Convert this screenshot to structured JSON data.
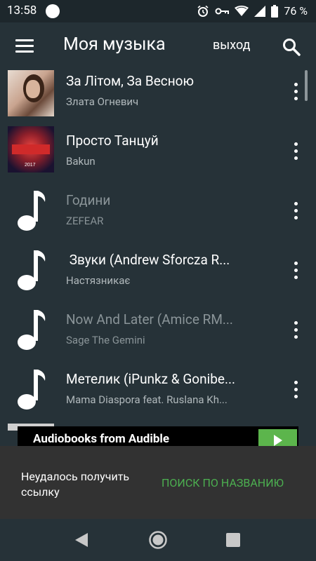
{
  "status_bar": {
    "time": "13:58",
    "battery": "76 %",
    "icons": [
      "alarm-icon",
      "vpn-key-icon",
      "wifi-icon",
      "signal-icon",
      "battery-icon"
    ]
  },
  "app_bar": {
    "title": "Моя музыка",
    "exit_label": "выход"
  },
  "tracks": [
    {
      "title": "За Літом, За Весною",
      "artist": "Злата Огневич",
      "has_cover": true,
      "dimmed": false
    },
    {
      "title": "Просто Танцуй",
      "artist": "Bakun",
      "has_cover": true,
      "dimmed": false
    },
    {
      "title": "Години",
      "artist": "ZEFEAR",
      "has_cover": false,
      "dimmed": true
    },
    {
      "title": " Звуки (Andrew Sforcza R...",
      "artist": "Настязникає",
      "has_cover": false,
      "dimmed": false
    },
    {
      "title": "Now And Later (Amice RM...",
      "artist": "Sage The Gemini",
      "has_cover": false,
      "dimmed": true
    },
    {
      "title": "Метелик (iPunkz & Gonibe...",
      "artist": "Mama Diaspora feat. Ruslana Kh...",
      "has_cover": false,
      "dimmed": false
    }
  ],
  "ad": {
    "text": "Audiobooks from Audible"
  },
  "snackbar": {
    "message": "Неудалось получить ссылку",
    "action": "ПОИСК ПО НАЗВАНИЮ"
  },
  "colors": {
    "background": "#263238",
    "dimmed_text": "#8a9498",
    "secondary_text": "#b0b8bb",
    "accent": "#4caf50"
  }
}
